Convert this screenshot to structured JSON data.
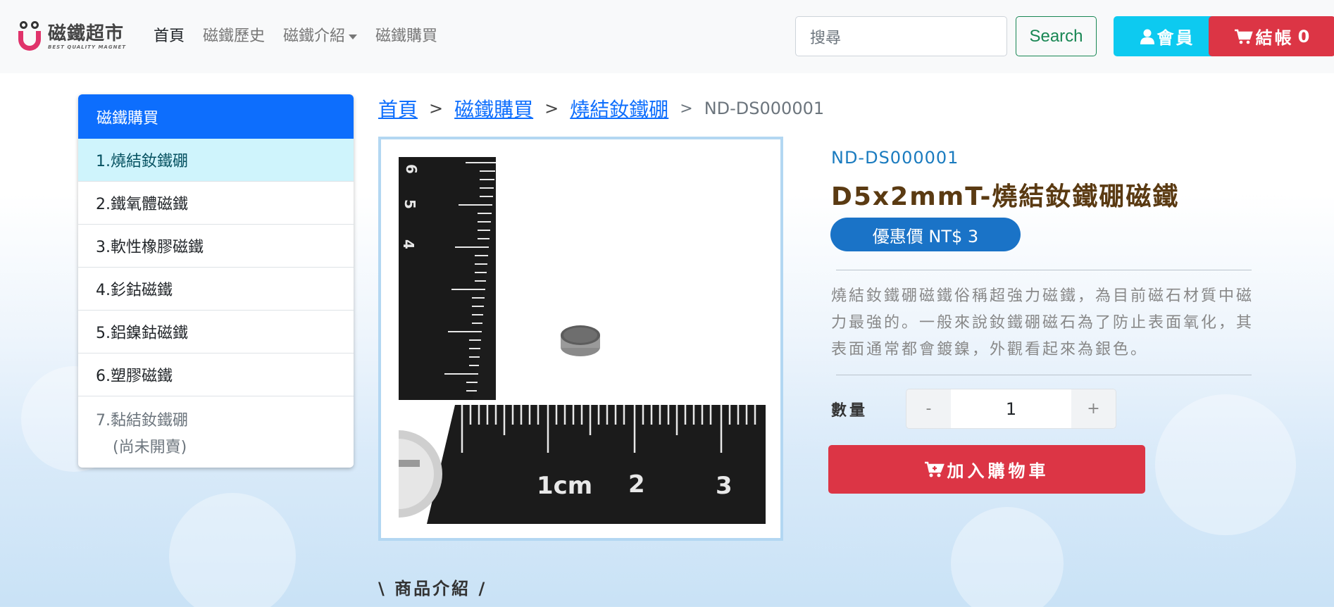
{
  "brand": {
    "name": "磁鐵超市",
    "tagline": "BEST QUALITY MAGNET"
  },
  "nav": {
    "links": [
      {
        "label": "首頁"
      },
      {
        "label": "磁鐵歷史"
      },
      {
        "label": "磁鐵介紹"
      },
      {
        "label": "磁鐵購買"
      }
    ]
  },
  "search": {
    "placeholder": "搜尋",
    "button_label": "Search"
  },
  "member_label": "會員",
  "cart_label": "結帳",
  "cart_count": "0",
  "sidebar": {
    "header": "磁鐵購買",
    "items": [
      {
        "label": "1.燒結釹鐵硼"
      },
      {
        "label": "2.鐵氧體磁鐵"
      },
      {
        "label": "3.軟性橡膠磁鐵"
      },
      {
        "label": "4.釤鈷磁鐵"
      },
      {
        "label": "5.鋁鎳鈷磁鐵"
      },
      {
        "label": "6.塑膠磁鐵"
      },
      {
        "label": "7.黏結釹鐵硼",
        "note": "(尚未開賣)"
      }
    ]
  },
  "breadcrumb": {
    "items": [
      "首頁",
      "磁鐵購買",
      "燒結釹鐵硼"
    ],
    "separator": ">",
    "current": "ND-DS000001"
  },
  "product": {
    "sku": "ND-DS000001",
    "title": "D5x2mmT-燒結釹鐵硼磁鐵",
    "price_label": "優惠價 NT$ 3",
    "description": "燒結釹鐵硼磁鐵俗稱超強力磁鐵，為目前磁石材質中磁力最強的。一般來說釹鐵硼磁石為了防止表面氧化，其表面通常都會鍍鎳，外觀看起來為銀色。",
    "quantity_label": "數量",
    "quantity": "1",
    "minus": "-",
    "plus": "+",
    "add_to_cart": "加入購物車"
  },
  "photo_marks": {
    "ruler_1cm": "1cm",
    "ruler_2": "2",
    "ruler_3": "3",
    "side_5": "5",
    "side_4": "4",
    "side_6": "6"
  },
  "section_heading": "\\ 商品介紹 /",
  "colors": {
    "primary": "#0d6efd",
    "info": "#0dcaf0",
    "danger": "#dc3545",
    "success": "#198754",
    "price_badge": "#1a73c7",
    "title_brown": "#5a3a12"
  }
}
